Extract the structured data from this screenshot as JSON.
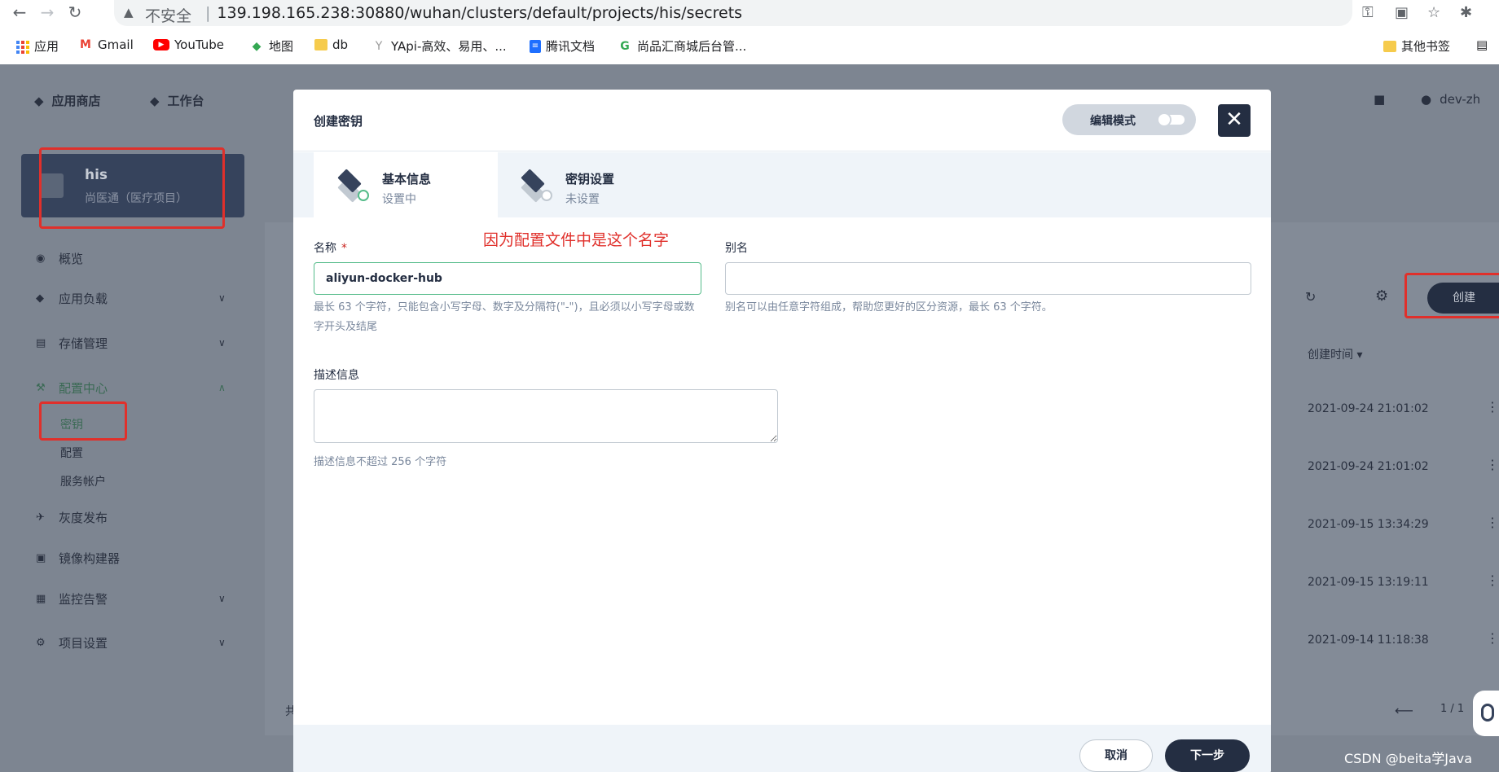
{
  "browser": {
    "insecure_label": "不安全",
    "url_separator": "|",
    "url": "139.198.165.238:30880/wuhan/clusters/default/projects/his/secrets",
    "bookmarks": [
      "应用",
      "Gmail",
      "YouTube",
      "地图",
      "db",
      "YApi-高效、易用、...",
      "腾讯文档",
      "尚品汇商城后台管..."
    ],
    "other_bookmarks": "其他书签"
  },
  "top_nav": {
    "app_store": "应用商店",
    "workbench": "工作台",
    "user": "dev-zh"
  },
  "project": {
    "name": "his",
    "description": "尚医通（医疗项目）"
  },
  "sidebar": {
    "overview": "概览",
    "workloads": "应用负载",
    "storage": "存储管理",
    "config_center": "配置中心",
    "config_sub": [
      "密钥",
      "配置",
      "服务帐户"
    ],
    "grayscale": "灰度发布",
    "image_builder": "镜像构建器",
    "monitoring": "监控告警",
    "project_settings": "项目设置"
  },
  "list": {
    "create_button": "创建",
    "created_time_header": "创建时间",
    "rows": [
      "2021-09-24 21:01:02",
      "2021-09-24 21:01:02",
      "2021-09-15 13:34:29",
      "2021-09-15 13:19:11",
      "2021-09-14 11:18:38"
    ],
    "pagination": "1 / 1",
    "total_prefix": "共"
  },
  "modal": {
    "title": "创建密钥",
    "edit_mode": "编辑模式",
    "steps": [
      {
        "title": "基本信息",
        "status": "设置中"
      },
      {
        "title": "密钥设置",
        "status": "未设置"
      }
    ],
    "annotation": "因为配置文件中是这个名字",
    "name_label": "名称",
    "name_required": "*",
    "name_value": "aliyun-docker-hub",
    "name_help": "最长 63 个字符，只能包含小写字母、数字及分隔符(\"-\")，且必须以小写字母或数字开头及结尾",
    "alias_label": "别名",
    "alias_value": "",
    "alias_help": "别名可以由任意字符组成，帮助您更好的区分资源，最长 63 个字符。",
    "desc_label": "描述信息",
    "desc_value": "",
    "desc_help": "描述信息不超过 256 个字符",
    "cancel": "取消",
    "next": "下一步"
  },
  "watermark": "CSDN @beita学Java"
}
